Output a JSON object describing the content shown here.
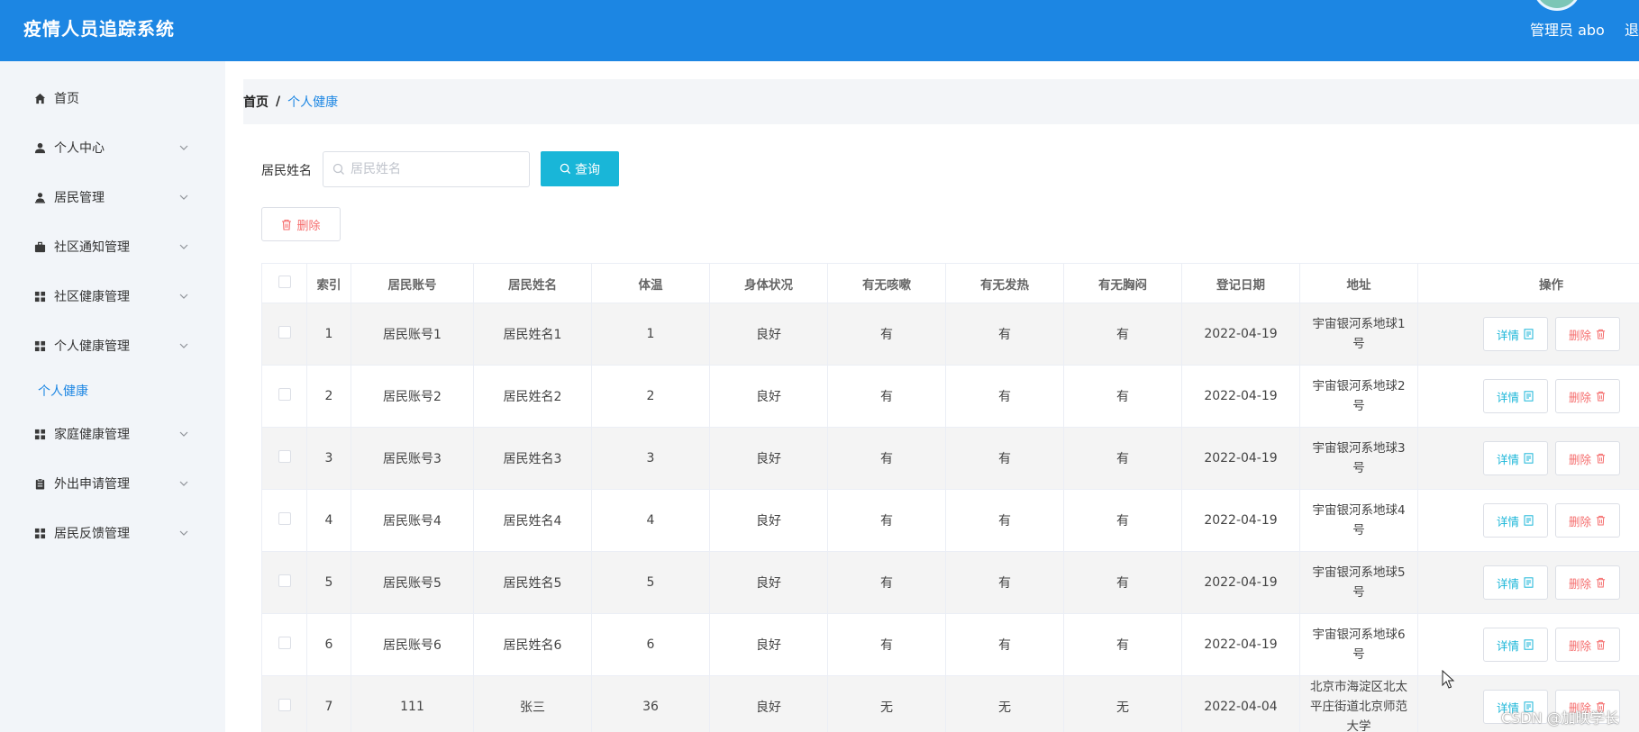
{
  "header": {
    "title": "疫情人员追踪系统",
    "admin_label": "管理员 abo",
    "logout_label": "退"
  },
  "sidebar": {
    "items": [
      {
        "label": "首页",
        "icon": "home-icon"
      },
      {
        "label": "个人中心",
        "icon": "user-icon"
      },
      {
        "label": "居民管理",
        "icon": "resident-icon"
      },
      {
        "label": "社区通知管理",
        "icon": "briefcase-icon"
      },
      {
        "label": "社区健康管理",
        "icon": "grid-icon"
      },
      {
        "label": "个人健康管理",
        "icon": "grid-icon"
      },
      {
        "label": "家庭健康管理",
        "icon": "grid-icon"
      },
      {
        "label": "外出申请管理",
        "icon": "clipboard-icon"
      },
      {
        "label": "居民反馈管理",
        "icon": "grid-icon"
      }
    ],
    "active_sub": "个人健康"
  },
  "breadcrumb": {
    "home": "首页",
    "sep": "/",
    "current": "个人健康"
  },
  "search": {
    "label": "居民姓名",
    "placeholder": "居民姓名",
    "value": "",
    "query_button": "查询",
    "delete_button": "删除"
  },
  "table": {
    "headers": [
      "索引",
      "居民账号",
      "居民姓名",
      "体温",
      "身体状况",
      "有无咳嗽",
      "有无发热",
      "有无胸闷",
      "登记日期",
      "地址",
      "操作"
    ],
    "rows": [
      {
        "index": "1",
        "account": "居民账号1",
        "name": "居民姓名1",
        "temp": "1",
        "condition": "良好",
        "cough": "有",
        "fever": "有",
        "chest": "有",
        "date": "2022-04-19",
        "address": "宇宙银河系地球1号"
      },
      {
        "index": "2",
        "account": "居民账号2",
        "name": "居民姓名2",
        "temp": "2",
        "condition": "良好",
        "cough": "有",
        "fever": "有",
        "chest": "有",
        "date": "2022-04-19",
        "address": "宇宙银河系地球2号"
      },
      {
        "index": "3",
        "account": "居民账号3",
        "name": "居民姓名3",
        "temp": "3",
        "condition": "良好",
        "cough": "有",
        "fever": "有",
        "chest": "有",
        "date": "2022-04-19",
        "address": "宇宙银河系地球3号"
      },
      {
        "index": "4",
        "account": "居民账号4",
        "name": "居民姓名4",
        "temp": "4",
        "condition": "良好",
        "cough": "有",
        "fever": "有",
        "chest": "有",
        "date": "2022-04-19",
        "address": "宇宙银河系地球4号"
      },
      {
        "index": "5",
        "account": "居民账号5",
        "name": "居民姓名5",
        "temp": "5",
        "condition": "良好",
        "cough": "有",
        "fever": "有",
        "chest": "有",
        "date": "2022-04-19",
        "address": "宇宙银河系地球5号"
      },
      {
        "index": "6",
        "account": "居民账号6",
        "name": "居民姓名6",
        "temp": "6",
        "condition": "良好",
        "cough": "有",
        "fever": "有",
        "chest": "有",
        "date": "2022-04-19",
        "address": "宇宙银河系地球6号"
      },
      {
        "index": "7",
        "account": "111",
        "name": "张三",
        "temp": "36",
        "condition": "良好",
        "cough": "无",
        "fever": "无",
        "chest": "无",
        "date": "2022-04-04",
        "address": "北京市海淀区北太平庄街道北京师范大学"
      }
    ],
    "detail_button": "详情",
    "delete_button": "删除"
  },
  "watermark": "CSDN @加映学长",
  "colors": {
    "header": "#1c86e3",
    "sidebar": "#f2f5f9",
    "query": "#19b6d8",
    "danger": "#f56c6c",
    "link": "#1c86e3"
  }
}
